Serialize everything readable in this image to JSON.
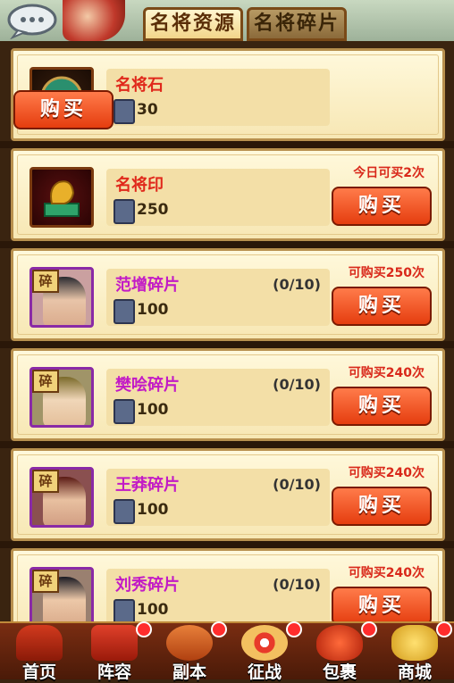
{
  "tabs": [
    {
      "label": "名将资源",
      "active": true
    },
    {
      "label": "名将碎片",
      "active": false
    }
  ],
  "items": [
    {
      "name": "名将石",
      "price": "30",
      "count": "",
      "limit": "",
      "buy": "购买",
      "name_color": "#e0281b",
      "icon": "green-jade-icon"
    },
    {
      "name": "名将印",
      "price": "250",
      "count": "",
      "limit": "今日可买2次",
      "buy": "购买",
      "name_color": "#e0281b",
      "icon": "golden-seal-icon"
    },
    {
      "name": "范增碎片",
      "price": "100",
      "count": "(0/10)",
      "limit": "可购买250次",
      "buy": "购买",
      "name_color": "#c21ac6",
      "icon": "hero-portrait-icon"
    },
    {
      "name": "樊哙碎片",
      "price": "100",
      "count": "(0/10)",
      "limit": "可购买240次",
      "buy": "购买",
      "name_color": "#c21ac6",
      "icon": "hero-portrait-icon"
    },
    {
      "name": "王莽碎片",
      "price": "100",
      "count": "(0/10)",
      "limit": "可购买240次",
      "buy": "购买",
      "name_color": "#c21ac6",
      "icon": "hero-portrait-icon"
    },
    {
      "name": "刘秀碎片",
      "price": "100",
      "count": "(0/10)",
      "limit": "可购买240次",
      "buy": "购买",
      "name_color": "#c21ac6",
      "icon": "hero-portrait-icon"
    }
  ],
  "fragment_badge": "碎",
  "bottom_nav": [
    {
      "label": "首页",
      "icon": "home-icon",
      "dot": false
    },
    {
      "label": "阵容",
      "icon": "banner-icon",
      "dot": true
    },
    {
      "label": "副本",
      "icon": "sword-icon",
      "dot": true
    },
    {
      "label": "征战",
      "icon": "target-icon",
      "dot": true
    },
    {
      "label": "包裹",
      "icon": "bag-icon",
      "dot": true
    },
    {
      "label": "商城",
      "icon": "shop-icon",
      "dot": true
    }
  ]
}
